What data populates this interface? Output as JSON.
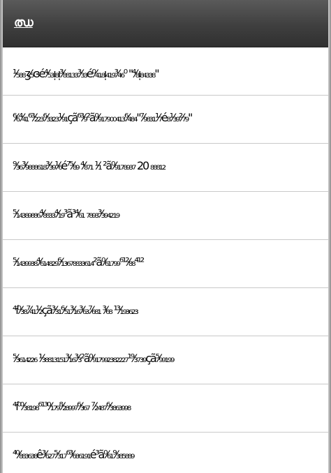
{
  "window": {
    "title": "ഝ"
  },
  "list": {
    "items": [
      {
        "text": "¹⁄₅₈₈ʒ⁄₅ɞé⁴⁄₅₃ᴉ₈ᴉ³⁄₈₈₁₃₃³⁄₃₃é⁰⁄₄₁₈ᴉ₄₁₉³⁄₄₆⁰ \"⁴⁄₈ᴉ₈₄₃₃₈\""
      },
      {
        "text": "⁶⁄₆⁴⁄₄₁⁶³⁄₂₂₃⁶⁄₃₃₂₃¹⁄₉₁çã⁶³⁄₉²ã⁰⁄₉₁₇₉₀₀₄₁₃⁶⁄₄₈₄\"⁷⁄₉₈₃₁¹⁄₇é₈¹⁄₃₉²⁄₇₉\""
      },
      {
        "text": "⁹⁄₃₆³⁄₉₈₈₈₆₁₈³⁄₃₉¹⁄₆é⁷⁵⁄₈₉ ⁴⁄₈₇₁ ¹⁄₁ ²ã⁰⁄₉₁₇₈₉₃₇ 20 ₈₈₈₁₂"
      },
      {
        "text": "⁵⁄₁₄₃₈₉₈₈₆⁴⁄₈₈₃₃⁴⁄₁₉³ã³⁴⁄₆₁ ₇₈₉₃³⁄₃₉₄₂₁₉"
      },
      {
        "text": "⁵⁄₁₄₃₉₉₃₈⁴⁄₆₁₄₈₂₉⁶⁄₁₃₆₇₈₈₃₃₆₁₄²ã⁰⁄₆₁₇₉₉⁶¹²⁄₈₈⁴¹²"
      },
      {
        "text": "⁴í⁰⁄₃₈⁷⁄₄₁¹⁄₂çã³⁄₃₁⁶⁄₅₁³⁄₁₆³⁄₆₃⁷⁄₆₈₁ ³⁄₆₈ ¹³⁄₁₉₃₆₂₃"
      },
      {
        "text": "⁵⁄₃₆₁₄₂₂₆ ¹⁄₃₈₈₁₃₁₅₁³⁄₁₆³⁄₃²ã⁰⁄₉₁₇₉₉₂₃₈₂₂₂₇¹⁹⁄₃₇₃₉çã⁵⁄₉₉₁₉₉"
      },
      {
        "text": "⁴í⁰⁰⁄₃₈₁₉₈⁶¹³⁰⁄₁₇₉⁸⁄₂₈₉₉₇⁶⁄₃₆₇ ⁷⁄₂₄₈₇⁶⁄₃₈₆₃₉₉₈"
      },
      {
        "text": "⁴⁰⁄₈₈₃₆₃₈ê³⁄₆₂₇⁵⁄₃₁₇⁶³⁄₆₈₆₁₉₁é³ã⁰⁄₆₁⁹⁄₃₈₅₈₈₉"
      }
    ]
  },
  "colors": {
    "titlebar": "#3f3f3f",
    "titlebar_text": "#ffffff",
    "divider": "#c9c9c9",
    "text": "#000000"
  }
}
